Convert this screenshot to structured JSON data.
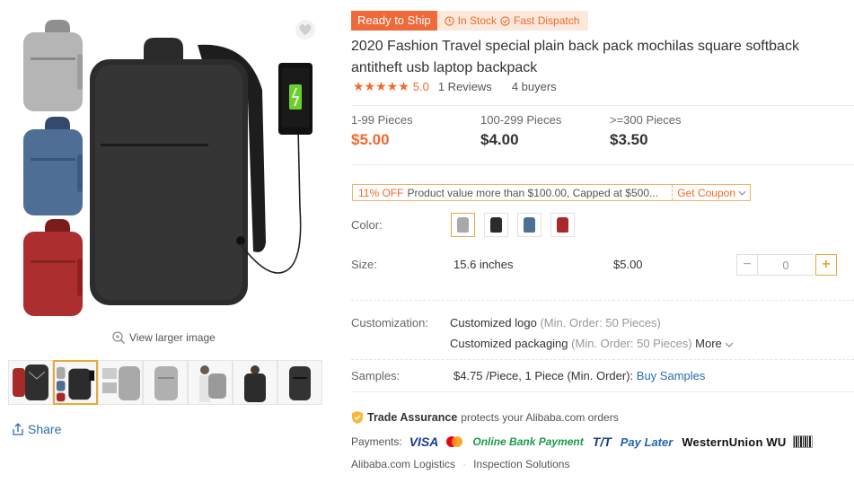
{
  "gallery": {
    "view_larger": "View larger image",
    "share": "Share",
    "thumbnails": [
      "thumb-1",
      "thumb-2",
      "thumb-3",
      "thumb-4",
      "thumb-5",
      "thumb-6",
      "thumb-7"
    ]
  },
  "badges": {
    "ready": "Ready to Ship",
    "in_stock": "In Stock",
    "fast_dispatch": "Fast Dispatch"
  },
  "product": {
    "title": "2020 Fashion Travel special plain back pack mochilas square softback antitheft usb laptop backpack",
    "rating": "5.0",
    "reviews": "1 Reviews",
    "buyers": "4 buyers"
  },
  "tiers": [
    {
      "label": "1-99 Pieces",
      "price": "$5.00"
    },
    {
      "label": "100-299 Pieces",
      "price": "$4.00"
    },
    {
      "label": ">=300 Pieces",
      "price": "$3.50"
    }
  ],
  "coupon": {
    "off": "11% OFF",
    "text": "Product value more than $100.00, Capped at $500...",
    "get": "Get Coupon"
  },
  "options": {
    "color_label": "Color:",
    "colors": [
      "#a9a9a9",
      "#2b2b2b",
      "#4e6e95",
      "#a72a2a"
    ],
    "size_label": "Size:",
    "size_name": "15.6 inches",
    "size_price": "$5.00",
    "quantity": "0"
  },
  "customization": {
    "label": "Customization:",
    "items": [
      {
        "name": "Customized logo",
        "min": "(Min. Order: 50 Pieces)"
      },
      {
        "name": "Customized packaging",
        "min": "(Min. Order: 50 Pieces)"
      }
    ],
    "more": "More"
  },
  "samples": {
    "label": "Samples:",
    "value": "$4.75 /Piece, 1 Piece (Min. Order):",
    "buy": "Buy Samples"
  },
  "trade": {
    "name": "Trade Assurance",
    "text": "protects your Alibaba.com orders"
  },
  "payments": {
    "label": "Payments:",
    "methods": [
      "VISA",
      "Online Bank Payment",
      "T/T",
      "Pay Later",
      "WesternUnion WU"
    ]
  },
  "footer": {
    "logistics": "Alibaba.com Logistics",
    "inspection": "Inspection Solutions"
  },
  "colors": {
    "accent": "#f2692e",
    "link": "#2b6cb0",
    "gold": "#e8a93c"
  }
}
